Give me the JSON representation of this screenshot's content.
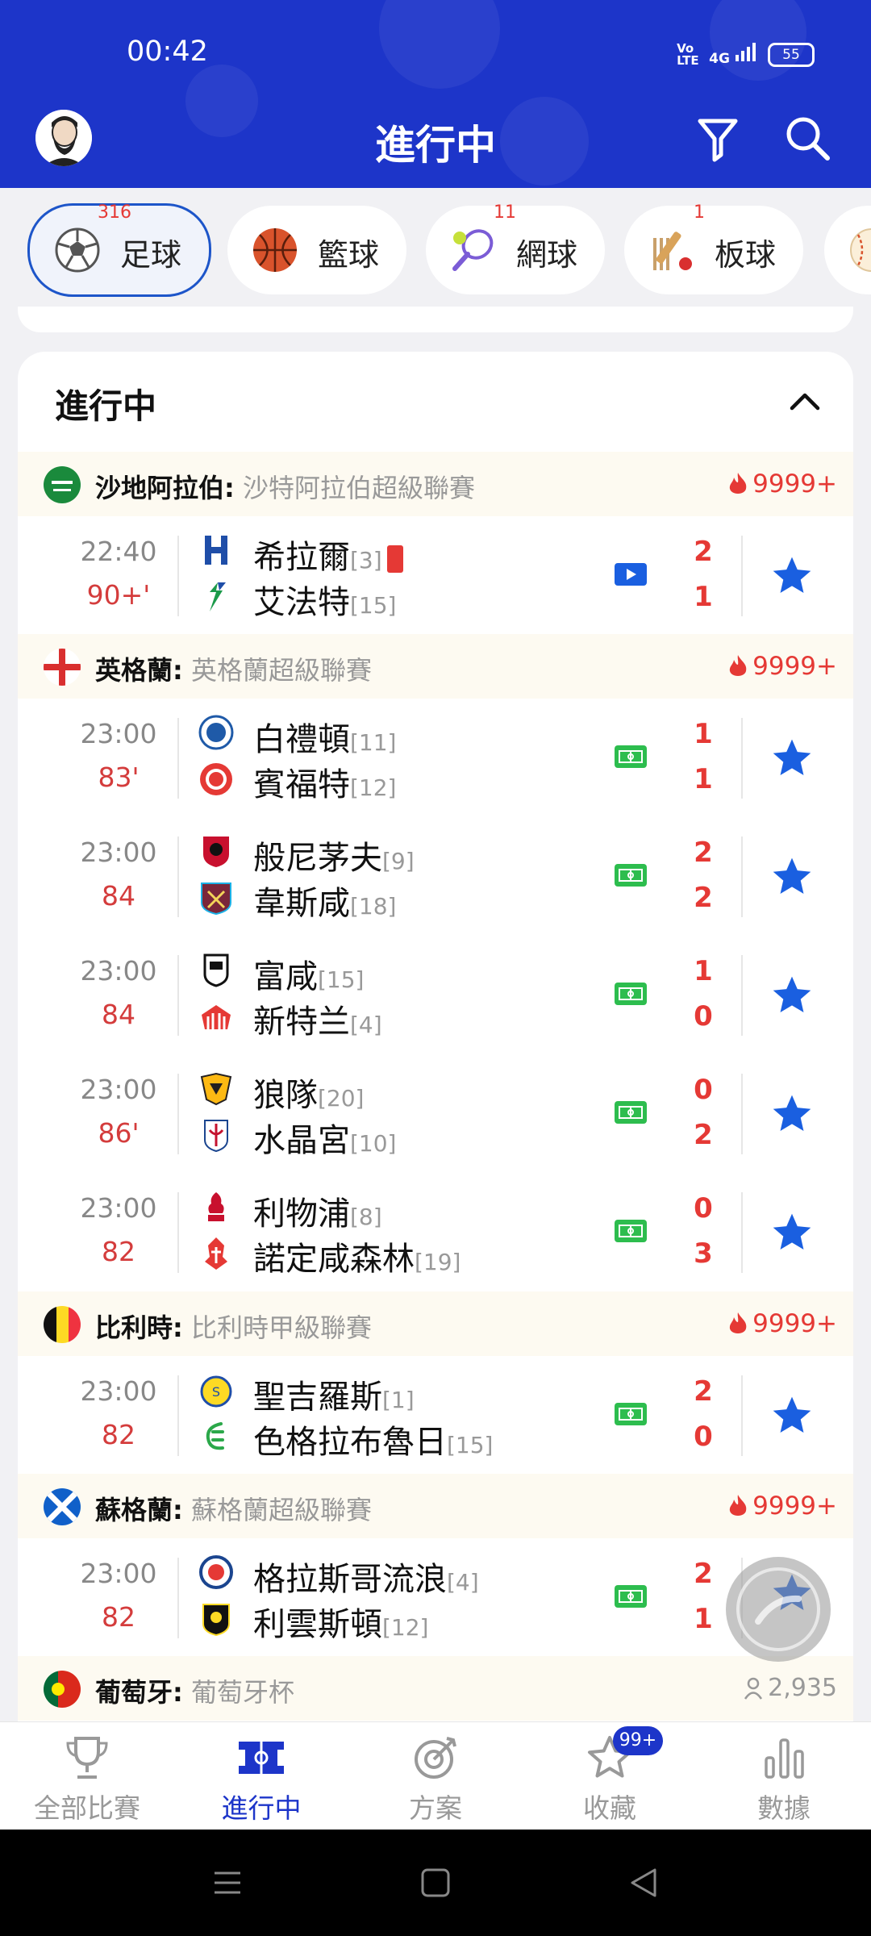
{
  "status_bar": {
    "time": "00:42",
    "network": "4G",
    "volte": "Vo LTE",
    "battery": "55"
  },
  "header": {
    "title": "進行中"
  },
  "sport_tabs": [
    {
      "label": "足球",
      "count": "316",
      "active": true
    },
    {
      "label": "籃球",
      "count": "",
      "active": false
    },
    {
      "label": "網球",
      "count": "11",
      "active": false
    },
    {
      "label": "板球",
      "count": "1",
      "active": false
    }
  ],
  "section": {
    "title": "進行中"
  },
  "leagues": [
    {
      "country": "沙地阿拉伯:",
      "competition": " 沙特阿拉伯超級聯賽",
      "hot": "9999+"
    },
    {
      "country": "英格蘭:",
      "competition": " 英格蘭超級聯賽",
      "hot": "9999+"
    },
    {
      "country": "比利時:",
      "competition": " 比利時甲級聯賽",
      "hot": "9999+"
    },
    {
      "country": "蘇格蘭:",
      "competition": " 蘇格蘭超級聯賽",
      "hot": "9999+"
    },
    {
      "country": "葡萄牙:",
      "competition": " 葡萄牙杯",
      "viewers": "2,935"
    }
  ],
  "matches": [
    {
      "time": "22:40",
      "minute": "90+'",
      "home": "希拉爾",
      "home_rank": "[3]",
      "away": "艾法特",
      "away_rank": "[15]",
      "home_score": "2",
      "away_score": "1"
    },
    {
      "time": "23:00",
      "minute": "83'",
      "home": "白禮頓",
      "home_rank": "[11]",
      "away": "賓福特",
      "away_rank": "[12]",
      "home_score": "1",
      "away_score": "1"
    },
    {
      "time": "23:00",
      "minute": "84",
      "home": "般尼茅夫",
      "home_rank": "[9]",
      "away": "韋斯咸",
      "away_rank": "[18]",
      "home_score": "2",
      "away_score": "2"
    },
    {
      "time": "23:00",
      "minute": "84",
      "home": "富咸",
      "home_rank": "[15]",
      "away": "新特兰",
      "away_rank": "[4]",
      "home_score": "1",
      "away_score": "0"
    },
    {
      "time": "23:00",
      "minute": "86'",
      "home": "狼隊",
      "home_rank": "[20]",
      "away": "水晶宮",
      "away_rank": "[10]",
      "home_score": "0",
      "away_score": "2"
    },
    {
      "time": "23:00",
      "minute": "82",
      "home": "利物浦",
      "home_rank": "[8]",
      "away": "諾定咸森林",
      "away_rank": "[19]",
      "home_score": "0",
      "away_score": "3"
    },
    {
      "time": "23:00",
      "minute": "82",
      "home": "聖吉羅斯",
      "home_rank": "[1]",
      "away": "色格拉布魯日",
      "away_rank": "[15]",
      "home_score": "2",
      "away_score": "0"
    },
    {
      "time": "23:00",
      "minute": "82",
      "home": "格拉斯哥流浪",
      "home_rank": "[4]",
      "away": "利雲斯頓",
      "away_rank": "[12]",
      "home_score": "2",
      "away_score": "1"
    }
  ],
  "bottom_nav": [
    {
      "label": "全部比賽"
    },
    {
      "label": "進行中"
    },
    {
      "label": "方案"
    },
    {
      "label": "收藏"
    },
    {
      "label": "數據"
    }
  ],
  "favorites_badge": "99+",
  "colors": {
    "brand": "#1d35c9",
    "live": "#e53935",
    "star": "#1a5fe0",
    "stream": "#2dbd4e"
  }
}
